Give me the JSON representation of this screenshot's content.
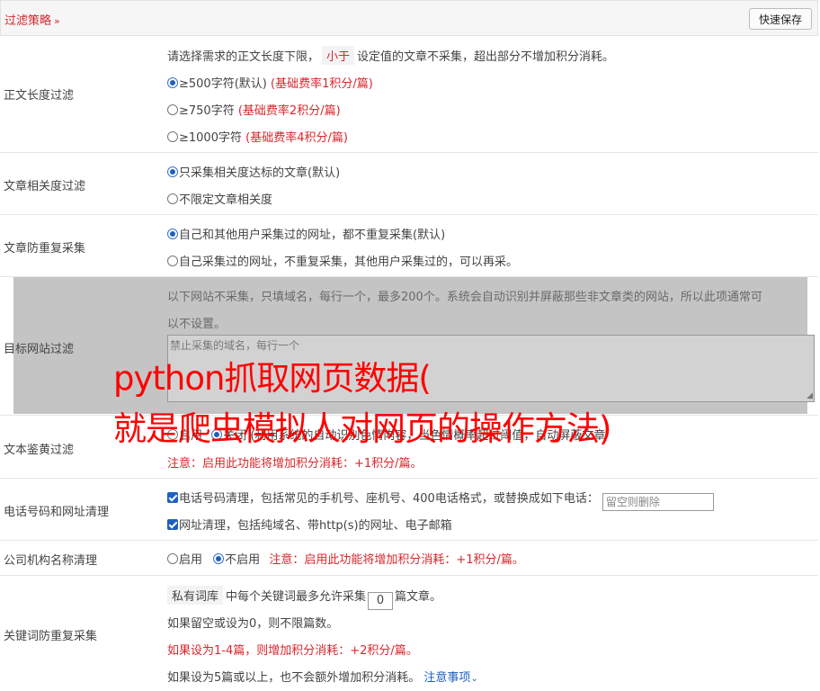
{
  "header": {
    "title": "过滤策略",
    "save_label": "快速保存"
  },
  "length_filter": {
    "label": "正文长度过滤",
    "desc_prefix": "请选择需求的正文长度下限，",
    "desc_tag": "小于",
    "desc_suffix": "设定值的文章不采集，超出部分不增加积分消耗。",
    "options": [
      {
        "text": "≥500字符(默认)",
        "note": "(基础费率1积分/篇)",
        "selected": true
      },
      {
        "text": "≥750字符",
        "note": "(基础费率2积分/篇)",
        "selected": false
      },
      {
        "text": "≥1000字符",
        "note": "(基础费率4积分/篇)",
        "selected": false
      }
    ]
  },
  "relevance_filter": {
    "label": "文章相关度过滤",
    "options": [
      {
        "text": "只采集相关度达标的文章(默认)",
        "selected": true
      },
      {
        "text": "不限定文章相关度",
        "selected": false
      }
    ]
  },
  "dedupe": {
    "label": "文章防重复采集",
    "options": [
      {
        "text": "自己和其他用户采集过的网址，都不重复采集(默认)",
        "selected": true
      },
      {
        "text": "自己采集过的网址，不重复采集，其他用户采集过的，可以再采。",
        "selected": false
      }
    ]
  },
  "site_filter": {
    "label": "目标网站过滤",
    "desc_line1": "以下网站不采集，只填域名，每行一个，最多200个。系统会自动识别并屏蔽那些非文章类的网站，所以此项通常可",
    "desc_line2": "以不设置。",
    "textarea_placeholder": "禁止采集的域名，每行一个"
  },
  "porn_filter": {
    "label": "文本鉴黄过滤",
    "option_on": "启用",
    "option_off": "关闭",
    "partial_desc": "(利用系统的自动识别色情内容，当色情概率超过阈值，自动屏蔽文章",
    "note": "注意：启用此功能将增加积分消耗：+1积分/篇。"
  },
  "phone_url": {
    "label": "电话号码和网址清理",
    "phone_text": "电话号码清理，包括常见的手机号、座机号、400电话格式，或替换成如下电话：",
    "phone_placeholder": "留空则删除",
    "url_text": "网址清理，包括纯域名、带http(s)的网址、电子邮箱"
  },
  "company": {
    "label": "公司机构名称清理",
    "option_on": "启用",
    "option_off": "不启用",
    "note": "注意：启用此功能将增加积分消耗：+1积分/篇。"
  },
  "keyword_dedupe": {
    "label": "关键词防重复采集",
    "tag": "私有词库",
    "line1_mid": "中每个关键词最多允许采集",
    "value": "0",
    "line1_suffix": "篇文章。",
    "line2": "如果留空或设为0，则不限篇数。",
    "line3": "如果设为1-4篇，则增加积分消耗：+2积分/篇。",
    "line4": "如果设为5篇或以上，也不会额外增加积分消耗。",
    "notice_link": "注意事项"
  },
  "overlay": {
    "line1": "python抓取网页数据(",
    "line2": "就是爬虫模拟人对网页的操作方法)"
  },
  "colors": {
    "accent_red": "#d9262c",
    "link_blue": "#1f5fbf",
    "overlay_red": "#ff0000"
  }
}
